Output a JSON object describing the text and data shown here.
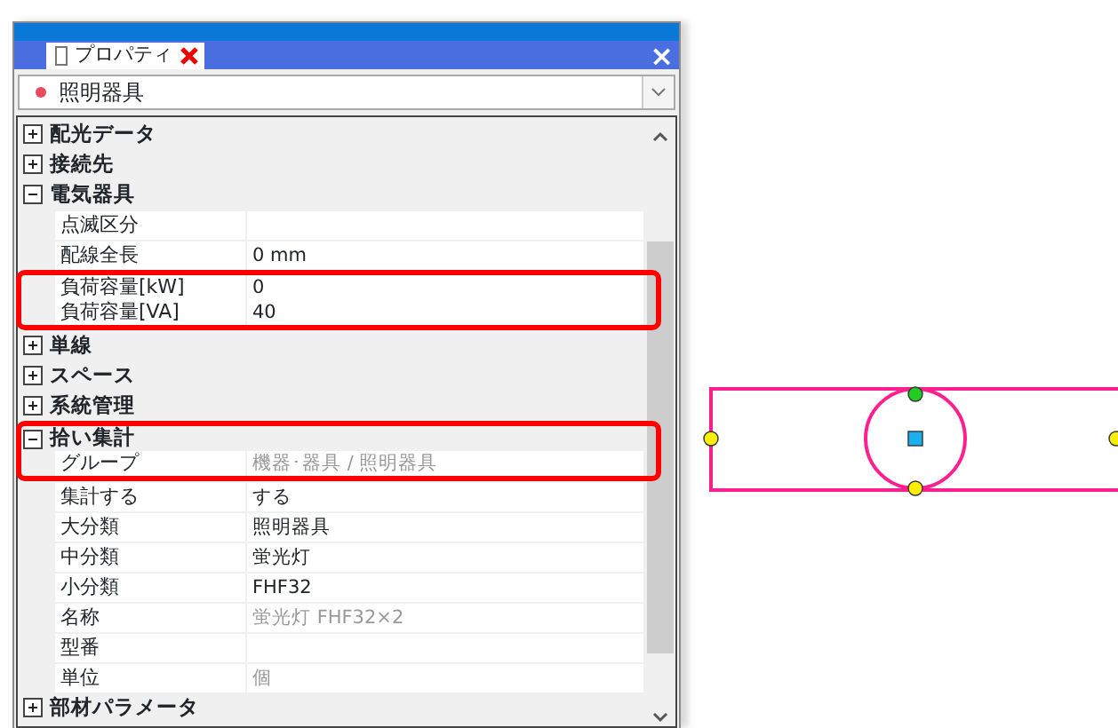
{
  "panel": {
    "tab": {
      "label": "プロパティ",
      "selected": true
    },
    "close": "×",
    "selector": {
      "value": "照明器具"
    },
    "categories": [
      {
        "label": "配光データ",
        "expanded": false,
        "highlighted": false
      },
      {
        "label": "接続先",
        "expanded": false,
        "highlighted": false
      },
      {
        "label": "電気器具",
        "expanded": true,
        "highlighted": false,
        "children": [
          {
            "label": "点滅区分",
            "highlighted": false
          },
          {
            "label": "配線全長",
            "value": "0 mm",
            "readonly": false,
            "highlighted": false
          },
          {
            "label": "負荷容量[kW]",
            "value": "0",
            "readonly": false,
            "highlighted": true
          },
          {
            "label": "負荷容量[VA]",
            "value": "40",
            "readonly": false,
            "highlighted": true
          }
        ]
      },
      {
        "label": "単線",
        "expanded": false,
        "highlighted": false
      },
      {
        "label": "スペース",
        "expanded": false,
        "highlighted": false
      },
      {
        "label": "系統管理",
        "expanded": false,
        "highlighted": false
      },
      {
        "label": "拾い集計",
        "expanded": true,
        "highlighted": true,
        "children": [
          {
            "label": "グループ",
            "value": "機器･器具 / 照明器具",
            "readonly": true,
            "highlighted": true
          },
          {
            "label": "集計する",
            "value": "する",
            "readonly": false,
            "highlighted": false
          },
          {
            "label": "大分類",
            "value": "照明器具",
            "readonly": false,
            "highlighted": false
          },
          {
            "label": "中分類",
            "value": "蛍光灯",
            "readonly": false,
            "highlighted": false
          },
          {
            "label": "小分類",
            "value": "FHF32",
            "readonly": false,
            "highlighted": false
          },
          {
            "label": "名称",
            "value": "蛍光灯 FHF32×2",
            "readonly": true,
            "highlighted": false
          },
          {
            "label": "型番",
            "highlighted": false
          },
          {
            "label": "単位",
            "value": "個",
            "readonly": true,
            "highlighted": false
          }
        ]
      },
      {
        "label": "部材パラメータ",
        "expanded": false,
        "highlighted": false
      }
    ]
  }
}
